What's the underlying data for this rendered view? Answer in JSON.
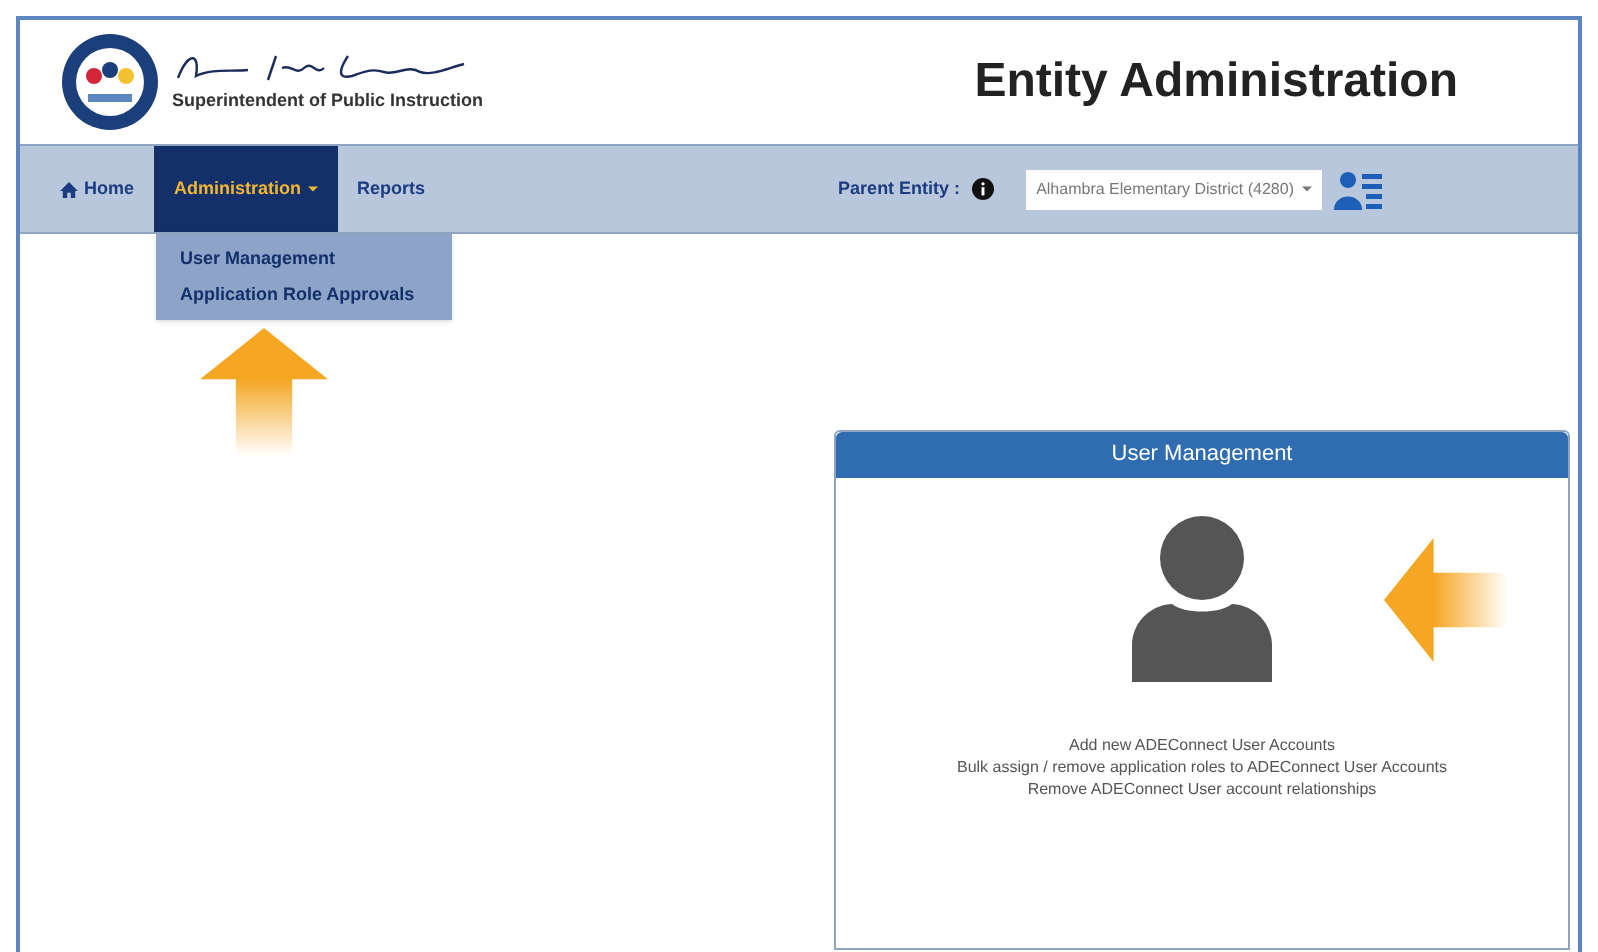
{
  "header": {
    "subtitle": "Superintendent of Public Instruction",
    "title": "Entity Administration"
  },
  "nav": {
    "items": [
      {
        "label": "Home",
        "kind": "home",
        "selected": false
      },
      {
        "label": "Administration",
        "kind": "dropdown",
        "selected": true
      },
      {
        "label": "Reports",
        "kind": "plain",
        "selected": false
      }
    ],
    "parent_entity": {
      "label": "Parent Entity :",
      "value": "Alhambra Elementary District (4280)"
    }
  },
  "menu": {
    "items": [
      "User Management",
      "Application Role Approvals"
    ]
  },
  "card": {
    "title": "User Management",
    "lines": [
      "Add new ADEConnect User Accounts",
      "Bulk assign / remove application roles to ADEConnect User Accounts",
      "Remove ADEConnect User account relationships"
    ]
  }
}
